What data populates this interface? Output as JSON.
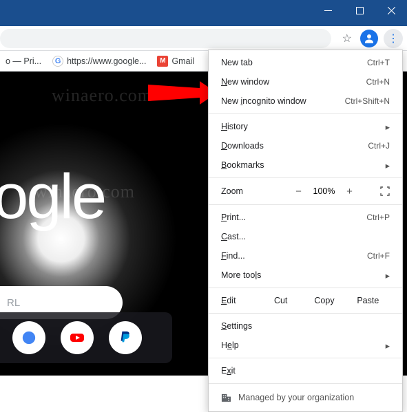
{
  "bookmarks": {
    "b1": "o — Pri...",
    "b2": "https://www.google...",
    "b3": "Gmail"
  },
  "page": {
    "logo": "oogle",
    "search_placeholder": "RL"
  },
  "menu": {
    "new_tab": "New tab",
    "new_tab_sc": "Ctrl+T",
    "new_window": "New window",
    "new_window_sc": "Ctrl+N",
    "incognito": "New incognito window",
    "incognito_sc": "Ctrl+Shift+N",
    "history": "History",
    "downloads": "Downloads",
    "downloads_sc": "Ctrl+J",
    "bookmarks": "Bookmarks",
    "zoom": "Zoom",
    "zoom_val": "100%",
    "print": "Print...",
    "print_sc": "Ctrl+P",
    "cast": "Cast...",
    "find": "Find...",
    "find_sc": "Ctrl+F",
    "more": "More tools",
    "edit": "Edit",
    "cut": "Cut",
    "copy": "Copy",
    "paste": "Paste",
    "settings": "Settings",
    "help": "Help",
    "exit": "Exit",
    "managed": "Managed by your organization"
  },
  "watermark": "winaero.com"
}
